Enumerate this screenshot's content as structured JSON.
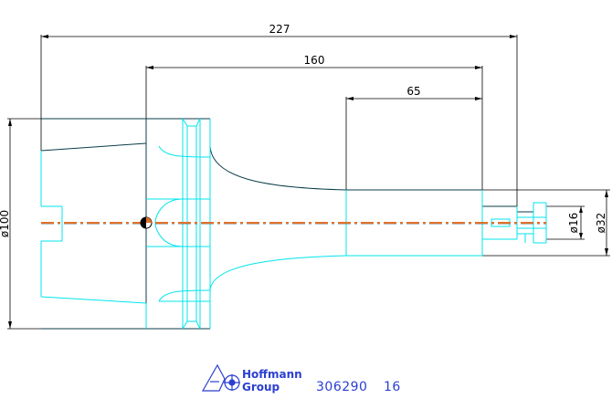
{
  "drawing": {
    "dimensions": {
      "overall_length": "227",
      "length_160": "160",
      "length_65": "65",
      "flange_diameter": "ø100",
      "shank_diameter": "ø32",
      "bore_diameter": "ø16"
    },
    "colors": {
      "outline": "#0a3d4a",
      "detail": "#00e5ee",
      "centerline": "#e0702a",
      "dimension": "#000000",
      "logo": "#2b3fd1"
    }
  },
  "footer": {
    "brand_line_1": "Hoffmann",
    "brand_line_2": "Group",
    "part_number": "306290",
    "revision": "16"
  }
}
